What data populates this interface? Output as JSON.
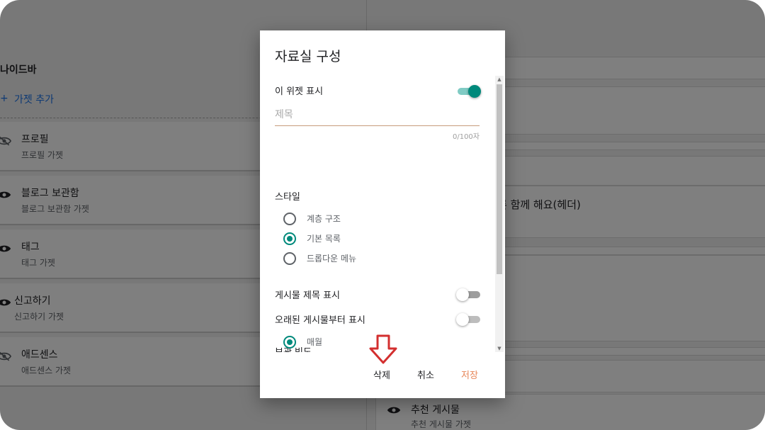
{
  "background": {
    "sidebar_title": "나이드바",
    "add_gadget": "가젯 추가",
    "cards": [
      {
        "title": "프로필",
        "subtitle": "프로필 가젯",
        "icon": "eye-off-icon"
      },
      {
        "title": "블로그 보관함",
        "subtitle": "블로그 보관함 가젯",
        "icon": "eye-icon"
      },
      {
        "title": "태그",
        "subtitle": "태그 가젯",
        "icon": "eye-icon"
      },
      {
        "title": "신고하기",
        "subtitle": "신고하기 가젯",
        "icon": "eye-icon"
      },
      {
        "title": "애드센스",
        "subtitle": "애드센스 가젯",
        "icon": "eye-off-icon"
      }
    ],
    "right_text": "른 함께 해요(헤더)",
    "right_card": {
      "title": "추천 게시물",
      "subtitle": "추천 게시물 가젯"
    }
  },
  "dialog": {
    "title": "자료실 구성",
    "show_widget_label": "이 위젯 표시",
    "show_widget_on": true,
    "title_field": {
      "placeholder": "제목",
      "value": "",
      "counter": "0/100자"
    },
    "style_label": "스타일",
    "style_options": [
      {
        "label": "계층 구조",
        "selected": false
      },
      {
        "label": "기본 목록",
        "selected": true
      },
      {
        "label": "드롭다운 메뉴",
        "selected": false
      }
    ],
    "show_post_titles_label": "게시물 제목 표시",
    "show_post_titles_on": false,
    "oldest_first_label": "오래된 게시물부터 표시",
    "oldest_first_on": false,
    "frequency_label": "보관 빈도",
    "frequency_options": [
      {
        "label": "매월",
        "selected": true
      }
    ],
    "buttons": {
      "delete": "삭제",
      "cancel": "취소",
      "save": "저장"
    }
  },
  "colors": {
    "accent": "#00897b",
    "save": "#e8875a",
    "annotation_arrow": "#d32f2f"
  }
}
